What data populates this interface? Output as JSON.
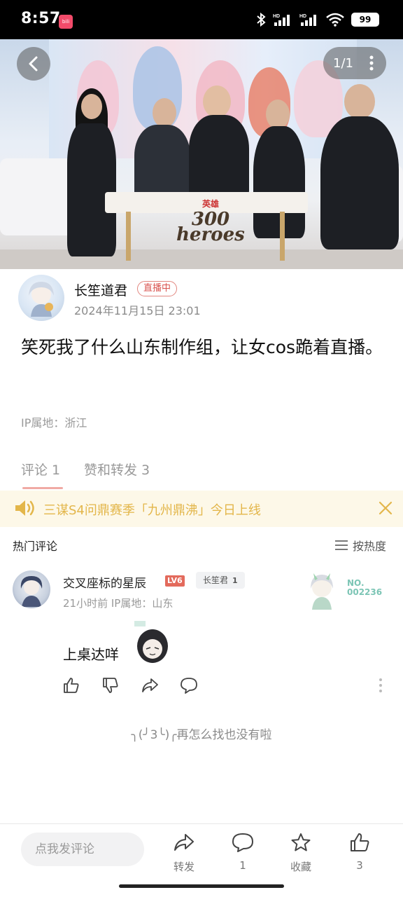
{
  "status_bar": {
    "time": "8:57",
    "app_icon": "bilibili-icon",
    "battery": "99",
    "signal_label_1": "HD",
    "signal_label_2": "HD"
  },
  "hero": {
    "pager": "1/1",
    "back_icon": "back-arrow-icon",
    "more_icon": "more-vertical-icon",
    "logo_line_1": "300",
    "logo_line_2": "heroes",
    "logo_cn": "英雄"
  },
  "post": {
    "author": "长笙道君",
    "live_badge": "直播中",
    "time": "2024年11月15日 23:01",
    "text": "笑死我了什么山东制作组，让女cos跪着直播。",
    "ip": "IP属地：浙江"
  },
  "tabs": [
    {
      "label": "评论 1",
      "active": true
    },
    {
      "label": "赞和转发 3",
      "active": false
    }
  ],
  "notice": {
    "text": "三谋S4问鼎赛季「九州鼎沸」今日上线",
    "icon": "speaker-icon",
    "accent": "#e3b64a"
  },
  "comments_header": {
    "title": "热门评论",
    "sort_label": "按热度"
  },
  "comment": {
    "author": "交叉座标的星辰",
    "level": "LV6",
    "fan_badge": "长笙君",
    "fan_level": "1",
    "meta": "21小时前 IP属地：山东",
    "decoration_no_label": "NO.",
    "decoration_no": "002236",
    "text": "上桌达咩"
  },
  "end_text": "╮(╯3╰)╭再怎么找也没有啦",
  "bottom_bar": {
    "input_placeholder": "点我发评论",
    "share_label": "转发",
    "comment_count": "1",
    "favorite_label": "收藏",
    "like_count": "3"
  }
}
